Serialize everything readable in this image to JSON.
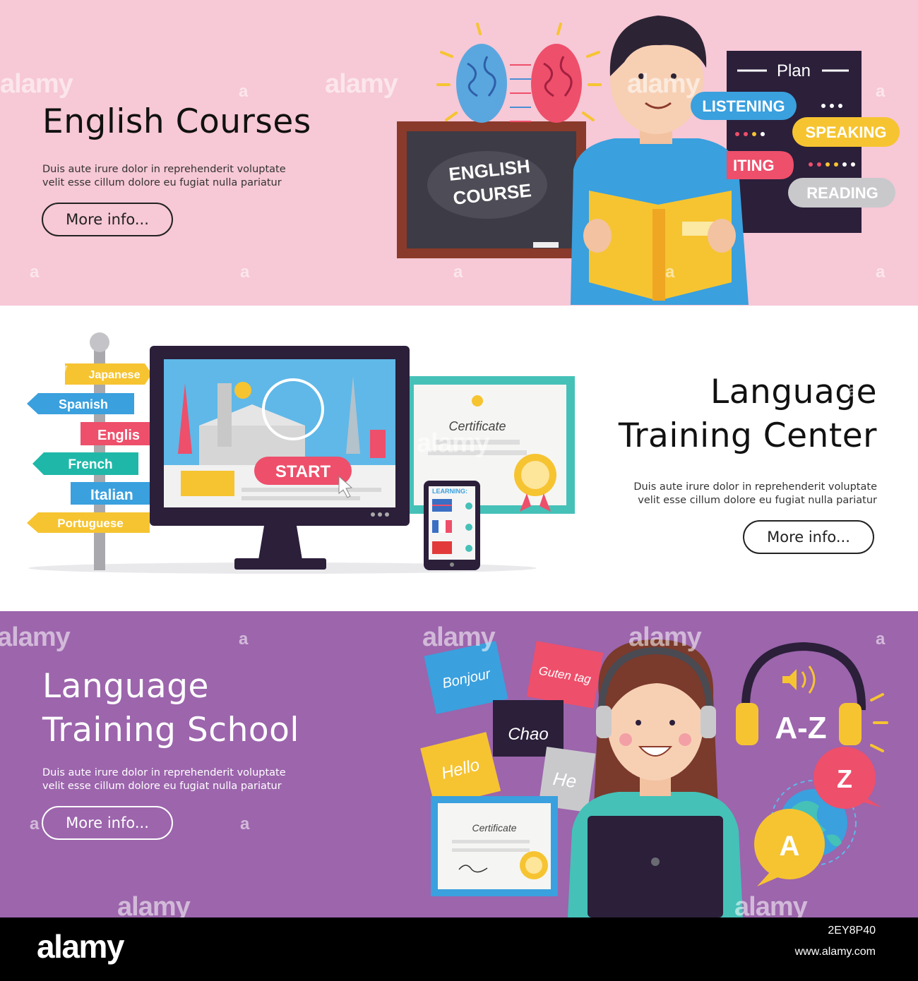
{
  "banner1": {
    "title": "English Courses",
    "desc_line1": "Duis aute irure dolor in reprehenderit voluptate",
    "desc_line2": "velit esse cillum dolore eu fugiat nulla pariatur",
    "button": "More info...",
    "board_line1": "ENGLISH",
    "board_line2": "COURSE",
    "plan_title": "Plan",
    "skills": [
      "LISTENING",
      "SPEAKING",
      "ITING",
      "READING"
    ]
  },
  "banner2": {
    "title_line1": "Language",
    "title_line2": "Training Center",
    "desc_line1": "Duis aute irure dolor in reprehenderit voluptate",
    "desc_line2": "velit esse cillum dolore eu fugiat nulla pariatur",
    "button": "More info...",
    "signs": [
      "Japanese",
      "Spanish",
      "Englis",
      "French",
      "Italian",
      "Portuguese"
    ],
    "start": "START",
    "certificate": "Certificate",
    "learning": "LEARNING:"
  },
  "banner3": {
    "title_line1": "Language",
    "title_line2": "Training School",
    "desc_line1": "Duis aute irure dolor in reprehenderit voluptate",
    "desc_line2": "velit esse cillum dolore eu fugiat nulla pariatur",
    "button": "More info...",
    "notes": [
      "Bonjour",
      "Guten tag",
      "Chao",
      "Hello",
      "He"
    ],
    "az": "A-Z",
    "bubble_z": "Z",
    "bubble_a": "A",
    "certificate": "Certificate"
  },
  "watermark": {
    "word": "alamy",
    "letter": "a"
  },
  "footer": {
    "logo": "alamy",
    "image_id": "2EY8P40",
    "url": "www.alamy.com"
  }
}
